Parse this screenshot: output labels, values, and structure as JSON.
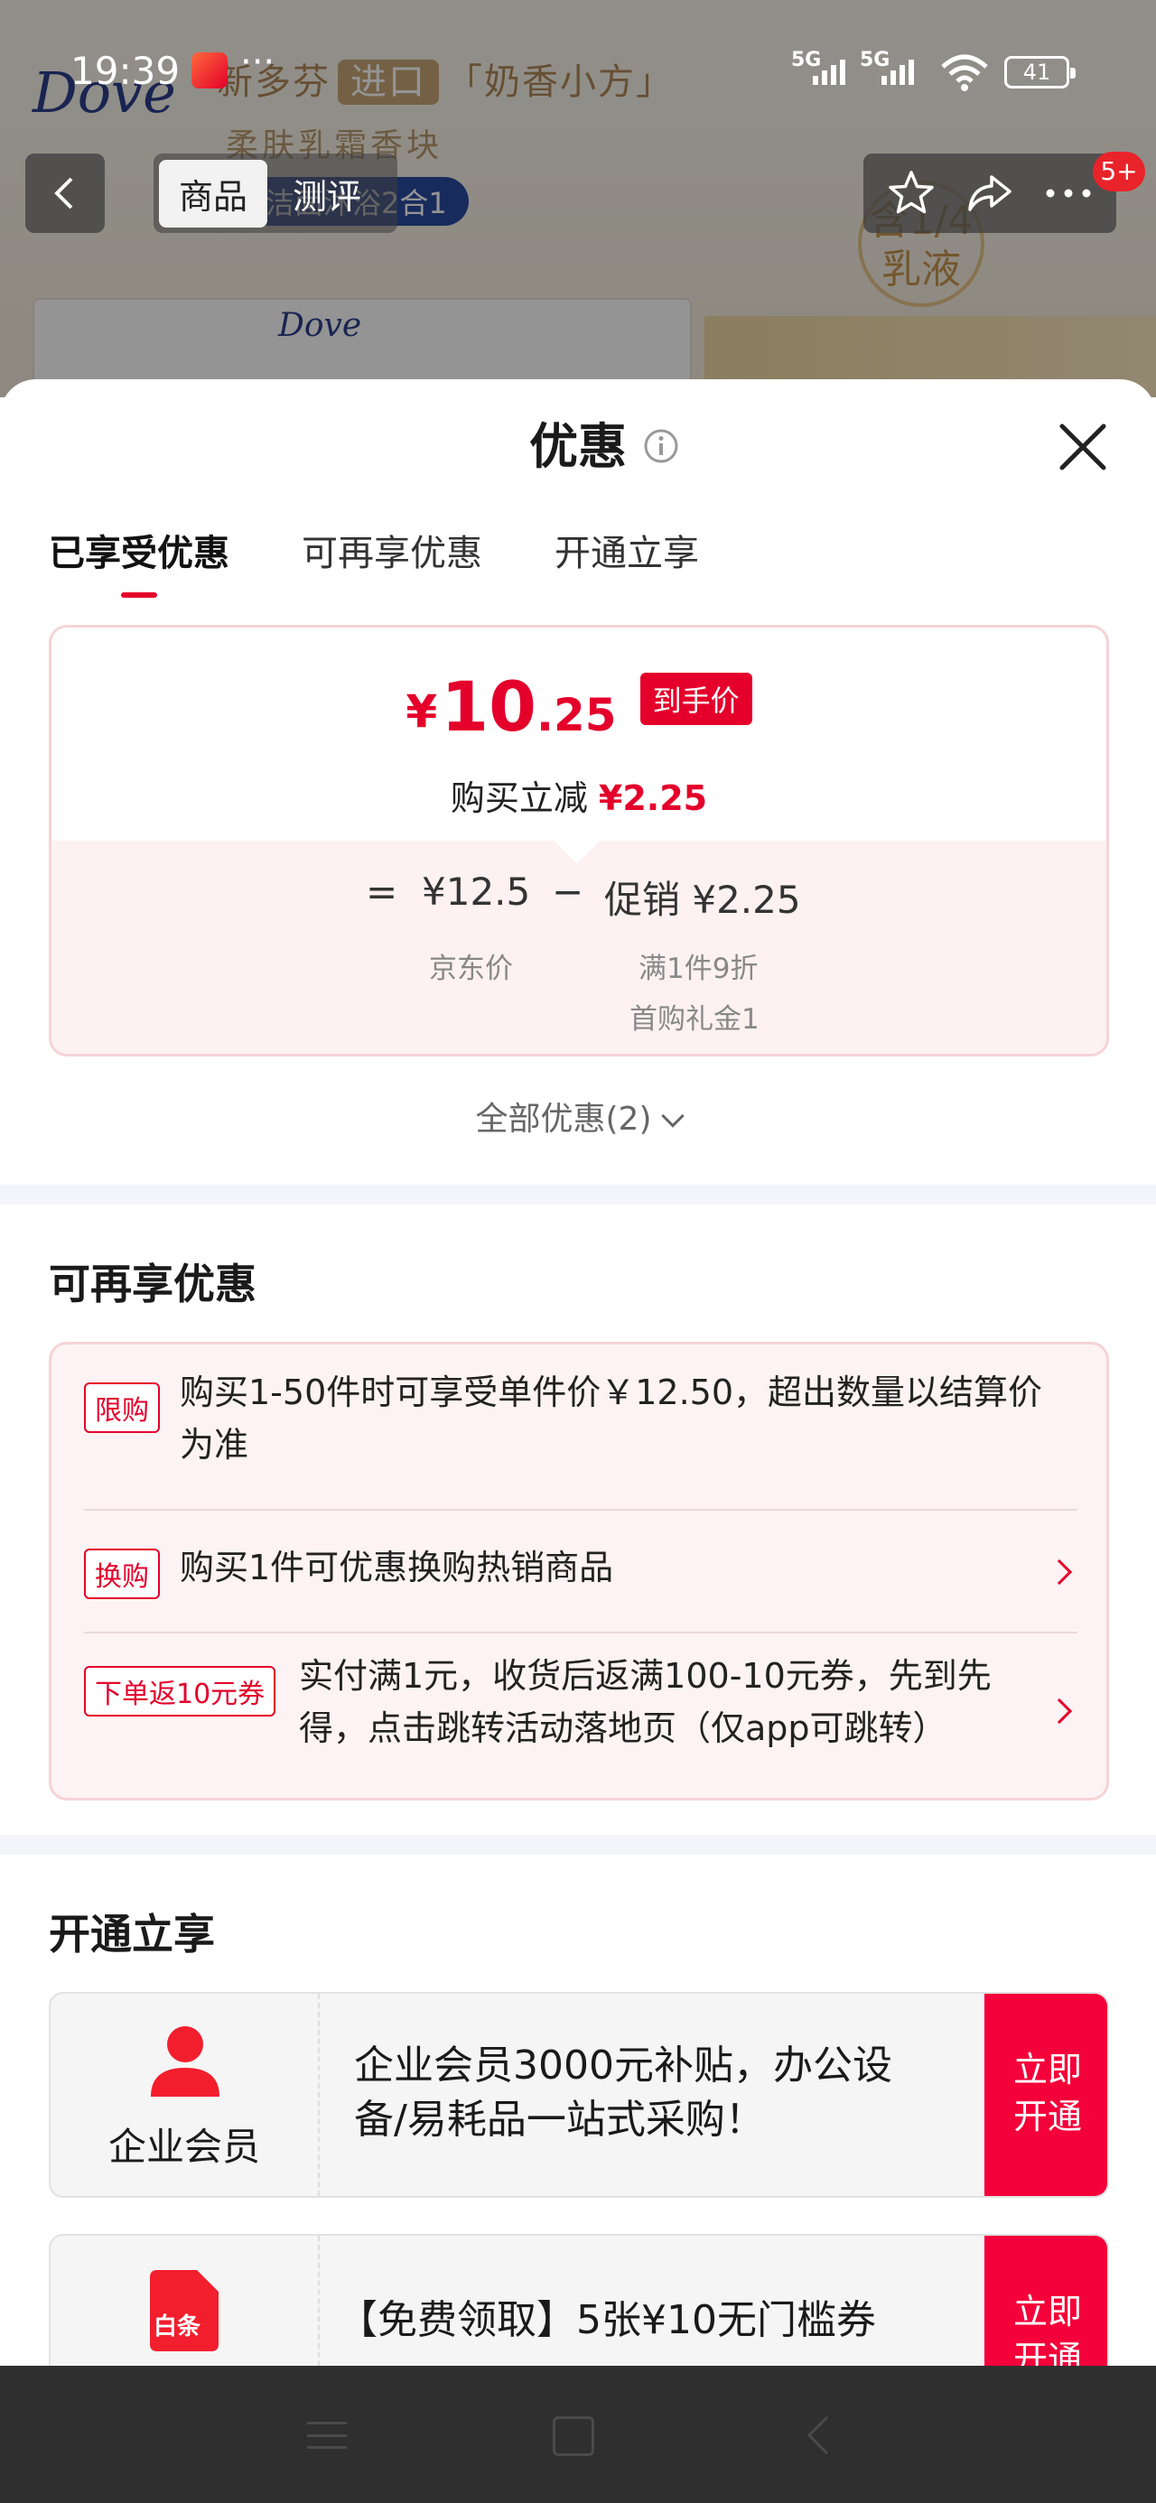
{
  "status_bar": {
    "time": "19:39",
    "more": "···",
    "signal1": "5G",
    "signal2": "5G",
    "battery": "41"
  },
  "background_product": {
    "brand": "Dove",
    "headline_pre": "新多芬",
    "headline_pill": "进口",
    "headline_post": "「奶香小方」",
    "subline": "柔肤乳霜香块",
    "pill_text": "洁面沐浴2合1",
    "badge_text": "含1/4 乳液",
    "box_brand": "Dove"
  },
  "nav": {
    "tab_product": "商品",
    "tab_review": "测评",
    "badge": "5+"
  },
  "sheet": {
    "title": "优惠",
    "tabs": [
      "已享受优惠",
      "可再享优惠",
      "开通立享"
    ],
    "price_card": {
      "yen": "¥",
      "price_int": "10",
      "price_dec": ".25",
      "price_tag": "到手价",
      "sub_label": "购买立减",
      "sub_value": "¥2.25",
      "eq": "=",
      "jd_price": "¥12.5",
      "minus": "−",
      "promo_label": "促销 ¥2.25",
      "jd_price_label": "京东价",
      "promo_detail1": "满1件9折",
      "promo_detail2": "首购礼金1"
    },
    "all_offers": "全部优惠(2)",
    "more_offers": {
      "title": "可再享优惠",
      "items": [
        {
          "tag": "限购",
          "text_line1": "购买1-50件时可享受单件价￥12.50，超出数量以结算价",
          "text_line2": "为准"
        },
        {
          "tag": "换购",
          "text_line1": "购买1件可优惠换购热销商品",
          "text_line2": ""
        },
        {
          "tag": "下单返10元券",
          "text_line1": "实付满1元，收货后返满100-10元券，先到先",
          "text_line2": "得，点击跳转活动落地页（仅app可跳转）"
        }
      ]
    },
    "open_now": {
      "title": "开通立享",
      "cards": [
        {
          "name": "企业会员",
          "text_line1": "企业会员3000元补贴，办公设",
          "text_line2": "备/易耗品一站式采购！",
          "btn_line1": "立即",
          "btn_line2": "开通"
        },
        {
          "name": "白条",
          "icon_text": "白条",
          "text_line1": "【免费领取】5张¥10无门槛券",
          "text_line2": "",
          "btn_line1": "立即",
          "btn_line2": "开通"
        }
      ]
    }
  },
  "colors": {
    "accent_red": "#e4002b",
    "button_red": "#f4003a",
    "soft_pink": "#fdf1f2"
  }
}
